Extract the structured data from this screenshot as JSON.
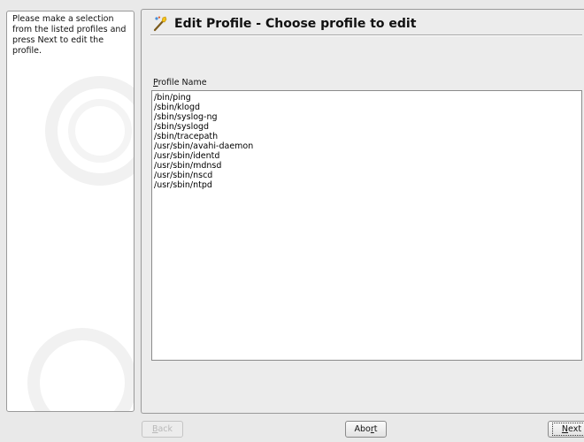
{
  "help": {
    "text": "Please make a selection from the listed profiles and press Next to edit the profile."
  },
  "header": {
    "title": "Edit Profile - Choose profile to edit"
  },
  "profile_list": {
    "label_mnemonic": "P",
    "label_rest": "rofile Name",
    "items": [
      "/bin/ping",
      "/sbin/klogd",
      "/sbin/syslog-ng",
      "/sbin/syslogd",
      "/sbin/tracepath",
      "/usr/sbin/avahi-daemon",
      "/usr/sbin/identd",
      "/usr/sbin/mdnsd",
      "/usr/sbin/nscd",
      "/usr/sbin/ntpd"
    ]
  },
  "buttons": {
    "back_mnemonic": "B",
    "back_rest": "ack",
    "abort_pre": "Abo",
    "abort_mnemonic": "r",
    "abort_post": "t",
    "next_mnemonic": "N",
    "next_rest": "ext"
  },
  "colors": {
    "window_bg": "#e9e9e9",
    "panel_bg": "#ffffff",
    "border": "#9a9a9a"
  }
}
